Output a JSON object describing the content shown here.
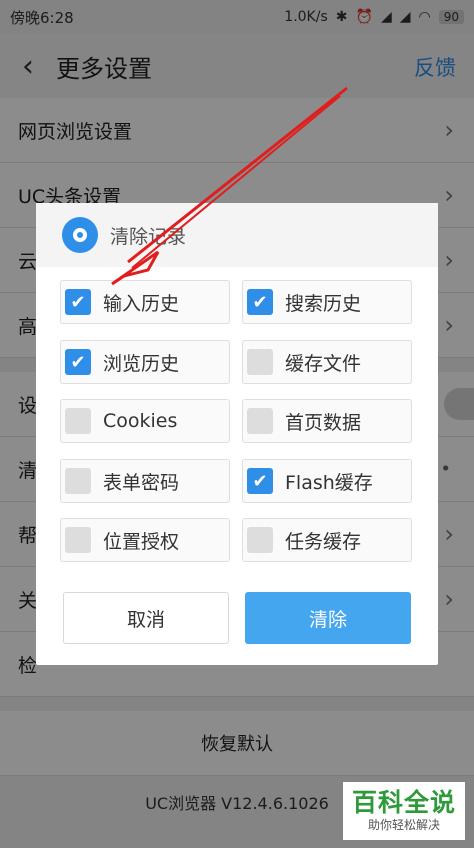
{
  "status_bar": {
    "time": "傍晚6:28",
    "speed": "1.0K/s",
    "battery": "90"
  },
  "appbar": {
    "back_icon": "chevron-left-icon",
    "title": "更多设置",
    "feedback": "反馈"
  },
  "settings_list": {
    "rows": [
      {
        "label": "网页浏览设置"
      },
      {
        "label": "UC头条设置"
      },
      {
        "label": "云"
      },
      {
        "label": "高"
      },
      {
        "label": "设"
      },
      {
        "label": "清"
      },
      {
        "label": "帮"
      },
      {
        "label": "关"
      },
      {
        "label": "检"
      }
    ],
    "restore_default": "恢复默认"
  },
  "version": "UC浏览器 V12.4.6.1026",
  "dialog": {
    "title": "清除记录",
    "icon": "gear-icon",
    "options": [
      {
        "label": "输入历史",
        "checked": true
      },
      {
        "label": "搜索历史",
        "checked": true
      },
      {
        "label": "浏览历史",
        "checked": true
      },
      {
        "label": "缓存文件",
        "checked": false
      },
      {
        "label": "Cookies",
        "checked": false
      },
      {
        "label": "首页数据",
        "checked": false
      },
      {
        "label": "表单密码",
        "checked": false
      },
      {
        "label": "Flash缓存",
        "checked": true
      },
      {
        "label": "位置授权",
        "checked": false
      },
      {
        "label": "任务缓存",
        "checked": false
      }
    ],
    "cancel_label": "取消",
    "clear_label": "清除"
  },
  "colors": {
    "accent": "#2e8ee8",
    "clear_button": "#43a6ee",
    "annotation_arrow": "#e01e1e"
  },
  "watermark": {
    "main": "百科全说",
    "sub": "助你轻松解决"
  }
}
